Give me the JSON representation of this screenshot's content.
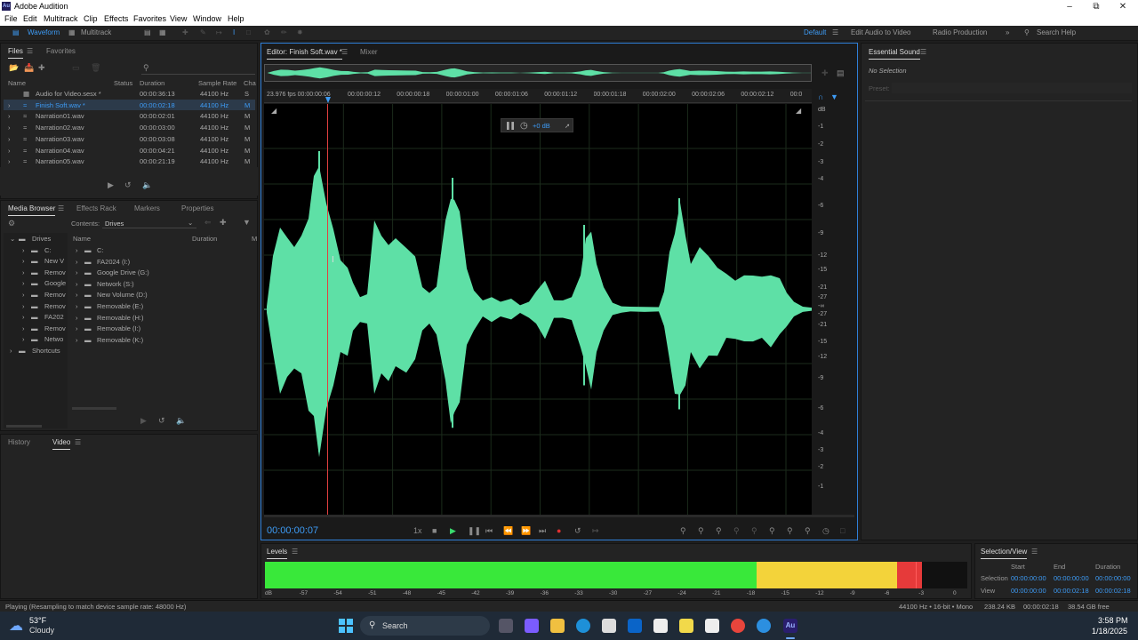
{
  "title_bar": {
    "app_icon": "Au",
    "title": "Adobe Audition"
  },
  "menu": [
    "File",
    "Edit",
    "Multitrack",
    "Clip",
    "Effects",
    "Favorites",
    "View",
    "Window",
    "Help"
  ],
  "toolbar": {
    "waveform_label": "Waveform",
    "multitrack_label": "Multitrack",
    "workspaces": [
      "Default",
      "Edit Audio to Video",
      "Radio Production"
    ],
    "search_placeholder": "Search Help"
  },
  "files_panel": {
    "tabs": [
      "Files",
      "Favorites"
    ],
    "columns": [
      "Name",
      "Status",
      "Duration",
      "Sample Rate",
      "Cha"
    ],
    "rows": [
      {
        "name": "Audio for Video.sesx *",
        "duration": "00:00:36:13",
        "rate": "44100 Hz",
        "ch": "S"
      },
      {
        "name": "Finish Soft.wav *",
        "duration": "00:00:02:18",
        "rate": "44100 Hz",
        "ch": "M"
      },
      {
        "name": "Narration01.wav",
        "duration": "00:00:02:01",
        "rate": "44100 Hz",
        "ch": "M"
      },
      {
        "name": "Narration02.wav",
        "duration": "00:00:03:00",
        "rate": "44100 Hz",
        "ch": "M"
      },
      {
        "name": "Narration03.wav",
        "duration": "00:00:03:08",
        "rate": "44100 Hz",
        "ch": "M"
      },
      {
        "name": "Narration04.wav",
        "duration": "00:00:04:21",
        "rate": "44100 Hz",
        "ch": "M"
      },
      {
        "name": "Narration05.wav",
        "duration": "00:00:21:19",
        "rate": "44100 Hz",
        "ch": "M"
      }
    ]
  },
  "media_browser": {
    "tabs": [
      "Media Browser",
      "Effects Rack",
      "Markers",
      "Properties"
    ],
    "contents_label": "Contents:",
    "contents_value": "Drives",
    "tree": [
      "Drives",
      "C:",
      "New V",
      "Remov",
      "Google",
      "Remov",
      "Remov",
      "FA202",
      "Remov",
      "Netwo",
      "Shortcuts"
    ],
    "columns": [
      "Name",
      "Duration",
      "M"
    ],
    "items": [
      "C:",
      "FA2024 (I:)",
      "Google Drive (G:)",
      "Network (S:)",
      "New Volume (D:)",
      "Removable (E:)",
      "Removable (H:)",
      "Removable (I:)",
      "Removable (K:)"
    ]
  },
  "history_tabs": [
    "History",
    "Video"
  ],
  "editor": {
    "tabs": [
      "Editor: Finish Soft.wav *",
      "Mixer"
    ],
    "timecode": "00:00:00:07",
    "hud_gain": "+0 dB",
    "ruler_labels": [
      "23.976 fps 00:00:00:06",
      "00:00:00:12",
      "00:00:00:18",
      "00:00:01:00",
      "00:00:01:06",
      "00:00:01:12",
      "00:00:01:18",
      "00:00:02:00",
      "00:00:02:06",
      "00:00:02:12",
      "00:0"
    ],
    "db_labels": [
      "dB",
      "-1",
      "-2",
      "-3",
      "-4",
      "-6",
      "-9",
      "-12",
      "-15",
      "-21",
      "-27",
      "-∞",
      "-27",
      "-21",
      "-15",
      "-12",
      "-9",
      "-6",
      "-4",
      "-3",
      "-2",
      "-1"
    ],
    "playback_rate": "1x",
    "waveform_color": "#5ee0a6"
  },
  "essential_sound": {
    "title": "Essential Sound",
    "no_selection": "No Selection",
    "preset_label": "Preset:"
  },
  "levels": {
    "title": "Levels",
    "scale": [
      "dB",
      "-57",
      "-54",
      "-51",
      "-48",
      "-45",
      "-42",
      "-39",
      "-36",
      "-33",
      "-30",
      "-27",
      "-24",
      "-21",
      "-18",
      "-15",
      "-12",
      "-9",
      "-6",
      "-3",
      "0"
    ],
    "green_to": 0.7,
    "yellow_to": 0.9,
    "red_to": 0.935
  },
  "selection_view": {
    "title": "Selection/View",
    "headers": [
      "Start",
      "End",
      "Duration"
    ],
    "selection_label": "Selection",
    "view_label": "View",
    "selection": [
      "00:00:00:00",
      "00:00:00:00",
      "00:00:00:00"
    ],
    "view": [
      "00:00:00:00",
      "00:00:02:18",
      "00:00:02:18"
    ]
  },
  "status": {
    "left": "Playing (Resampling to match device sample rate: 48000 Hz)",
    "format": "44100 Hz • 16-bit • Mono",
    "size": "238.24 KB",
    "duration": "00:00:02:18",
    "free": "38.54 GB free"
  },
  "taskbar": {
    "temp": "53°F",
    "weather": "Cloudy",
    "search": "Search",
    "time": "3:58 PM",
    "date": "1/18/2025"
  }
}
